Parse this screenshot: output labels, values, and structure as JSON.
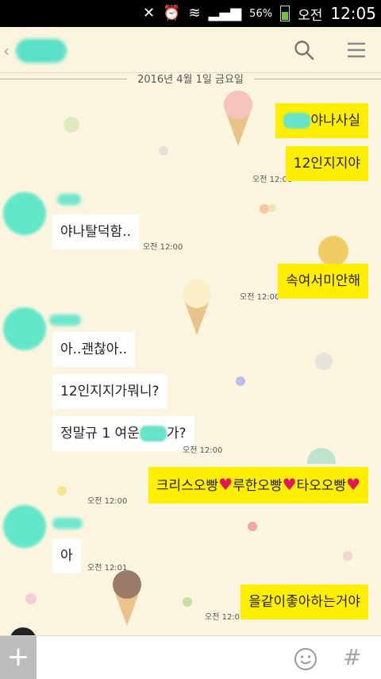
{
  "status_bar": {
    "battery_percent": "56%",
    "period": "오전",
    "time": "12:05"
  },
  "header": {
    "back_icon": "chevron-left",
    "search_icon": "search",
    "menu_icon": "hamburger-menu"
  },
  "date_divider": "2016년 4월 1일 금요일",
  "messages": [
    {
      "from": "me",
      "text": "야나사실"
    },
    {
      "from": "me",
      "text": "12인지지야",
      "time": "오전 12:00"
    },
    {
      "from": "other",
      "text": "야나탈덕함..",
      "time": "오전 12:00"
    },
    {
      "from": "me",
      "text": "속여서미안해",
      "time": "오전 12:00"
    },
    {
      "from": "other",
      "text": "아..괜찮아.."
    },
    {
      "from": "other",
      "text": "12인지지가뭐니?"
    },
    {
      "from": "other",
      "text_before": "정말규 1 여운",
      "text_after": "가?",
      "time": "오전 12:00"
    },
    {
      "from": "me",
      "parts": [
        "크리스오빵",
        "루한오빵",
        "타오오빵"
      ],
      "time": "오전 12:00"
    },
    {
      "from": "other",
      "text": "아",
      "time": "오전 12:01"
    },
    {
      "from": "me",
      "text": "을같이좋아하는거야",
      "time": "오전 12:01"
    }
  ],
  "input_bar": {
    "plus_label": "+",
    "hash_label": "#"
  },
  "colors": {
    "my_bubble": "#ffee00",
    "other_bubble": "#ffffff",
    "background": "#fbf5df",
    "blur_redaction": "#62e6c9",
    "heart": "#e3155c"
  }
}
